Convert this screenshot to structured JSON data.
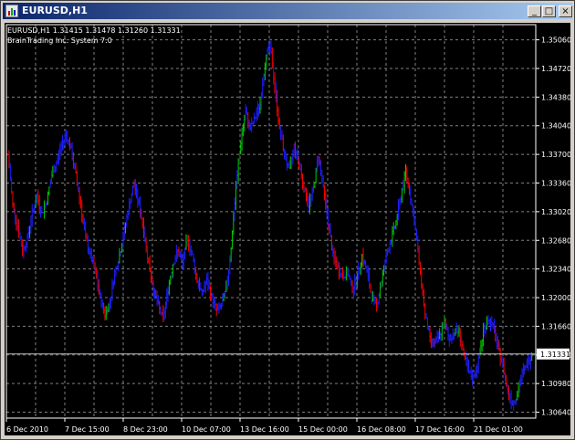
{
  "window": {
    "title": "EURUSD,H1",
    "buttons": {
      "minimize": "_",
      "maximize": "□",
      "close": "×"
    }
  },
  "chart": {
    "symbol_info": "EURUSD,H1  1.31415 1.31478 1.31260 1.31331",
    "system_label": "BrainTrading Inc. System 7.0",
    "current_price": "1.31331",
    "y_ticks": [
      "1.35060",
      "1.34720",
      "1.34380",
      "1.34040",
      "1.33700",
      "1.33360",
      "1.33020",
      "1.32680",
      "1.32340",
      "1.32000",
      "1.31660",
      "1.31320",
      "1.30980",
      "1.30640"
    ],
    "x_ticks": [
      "6 Dec 2010",
      "7 Dec 15:00",
      "8 Dec 23:00",
      "10 Dec 07:00",
      "13 Dec 16:00",
      "15 Dec 00:00",
      "16 Dec 08:00",
      "17 Dec 16:00",
      "21 Dec 01:00"
    ],
    "colors": {
      "background": "#000000",
      "grid": "#7f7f7f",
      "up_bar": "#00cc00",
      "down_bar": "#ff0000",
      "neutral_bar": "#1e1eff",
      "text": "#ffffff",
      "price_tag_bg": "#ffffff",
      "price_line": "#c0c0c0"
    }
  },
  "chart_data": {
    "type": "bar",
    "title": "EURUSD,H1",
    "ylim": [
      1.3057,
      1.3524
    ],
    "x_range": [
      "6 Dec 2010",
      "22 Dec 2010"
    ],
    "series": [
      {
        "name": "",
        "values": [
          1.337,
          1.331,
          1.3285,
          1.3255,
          1.327,
          1.33,
          1.332,
          1.33,
          1.3315,
          1.3345,
          1.336,
          1.338,
          1.3395,
          1.3375,
          1.3345,
          1.331,
          1.327,
          1.325,
          1.323,
          1.32,
          1.318,
          1.3195,
          1.323,
          1.325,
          1.328,
          1.331,
          1.3335,
          1.331,
          1.328,
          1.324,
          1.321,
          1.319,
          1.3175,
          1.321,
          1.324,
          1.3255,
          1.324,
          1.327,
          1.325,
          1.322,
          1.3205,
          1.322,
          1.32,
          1.3185,
          1.319,
          1.321,
          1.326,
          1.333,
          1.3385,
          1.342,
          1.34,
          1.3415,
          1.343,
          1.348,
          1.35,
          1.345,
          1.34,
          1.337,
          1.335,
          1.338,
          1.336,
          1.333,
          1.331,
          1.333,
          1.337,
          1.333,
          1.329,
          1.325,
          1.3235,
          1.3225,
          1.323,
          1.321,
          1.3225,
          1.325,
          1.323,
          1.32,
          1.319,
          1.322,
          1.325,
          1.327,
          1.329,
          1.332,
          1.335,
          1.332,
          1.328,
          1.323,
          1.318,
          1.315,
          1.3145,
          1.3155,
          1.317,
          1.315,
          1.316,
          1.316,
          1.313,
          1.311,
          1.3105,
          1.3125,
          1.316,
          1.3175,
          1.3165,
          1.314,
          1.312,
          1.309,
          1.3075,
          1.3085,
          1.311,
          1.312,
          1.3133
        ]
      }
    ]
  }
}
